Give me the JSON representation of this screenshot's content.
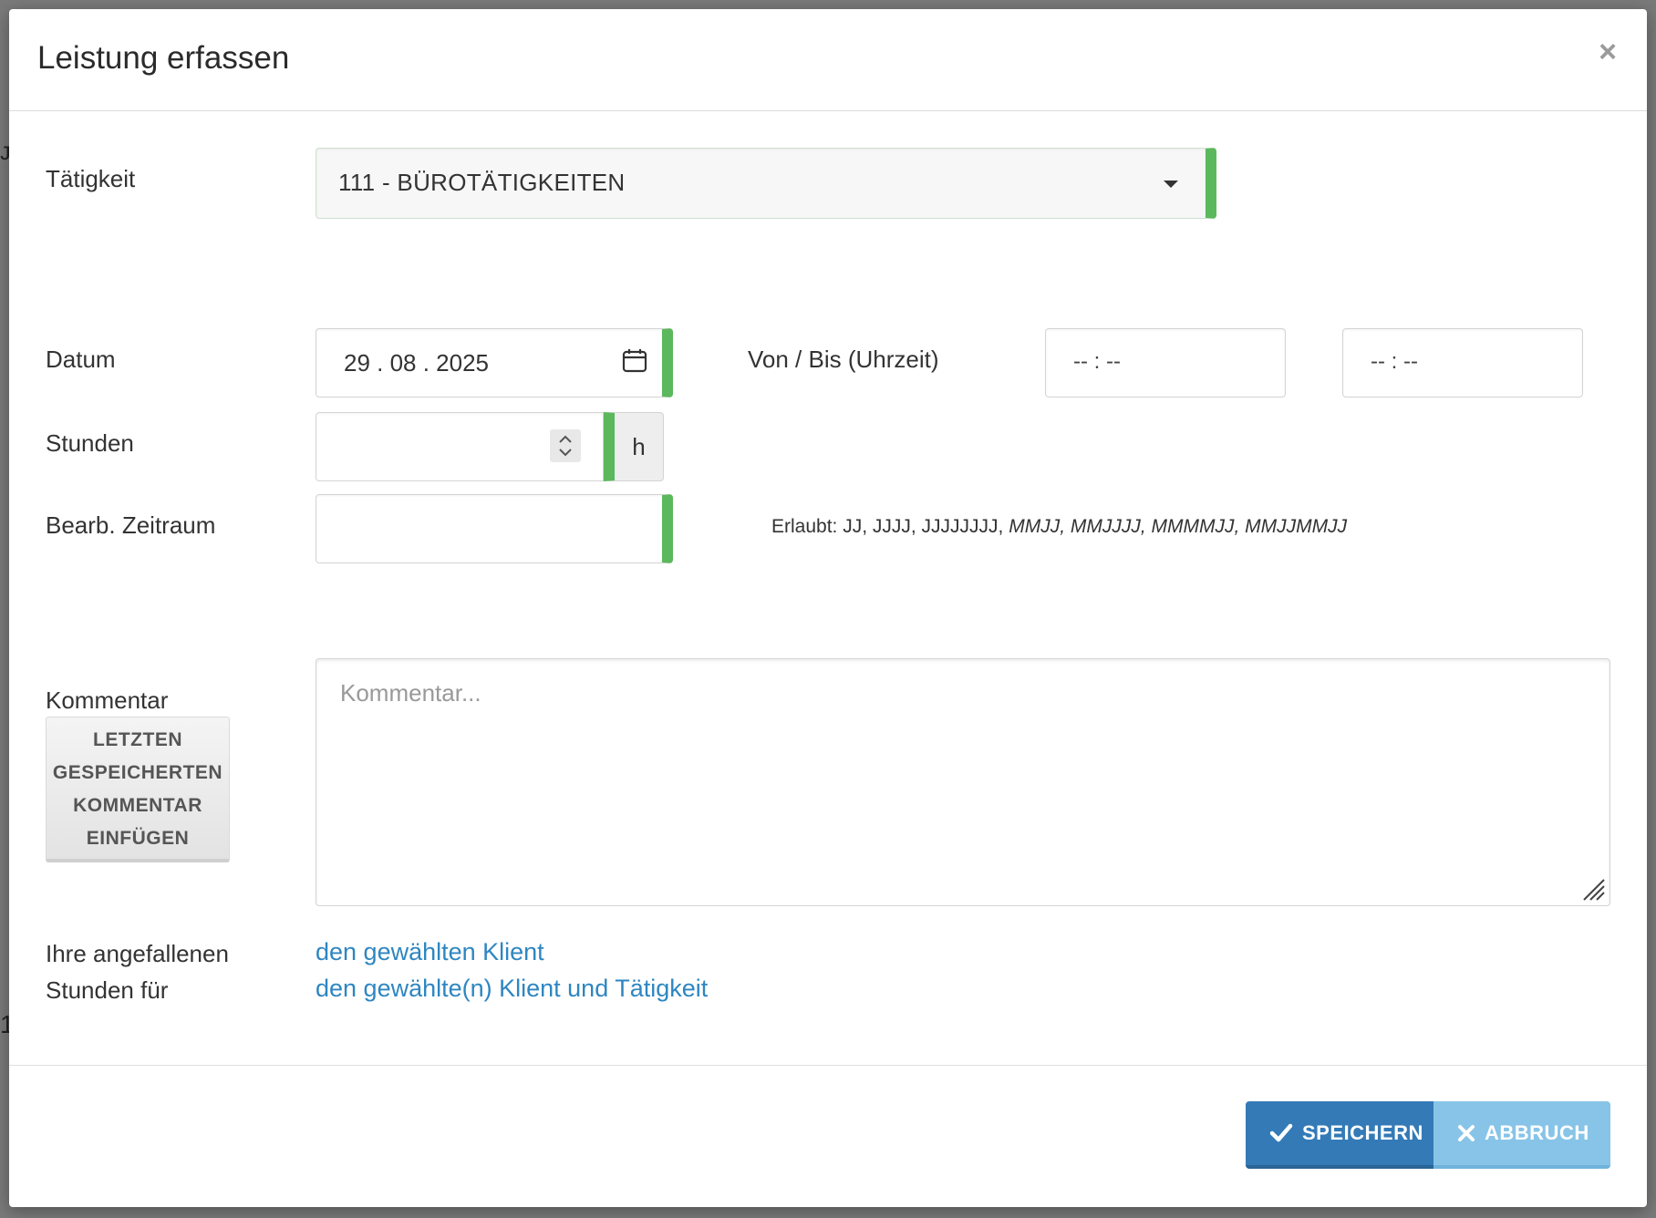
{
  "modal": {
    "title": "Leistung erfassen",
    "close_symbol": "×"
  },
  "fields": {
    "taetigkeit_label": "Tätigkeit",
    "taetigkeit_value": "111 - BÜROTÄTIGKEITEN",
    "datum_label": "Datum",
    "datum_value": "29 . 08 . 2025",
    "von_bis_label": "Von / Bis (Uhrzeit)",
    "von_value": "-- : --",
    "bis_value": "-- : --",
    "stunden_label": "Stunden",
    "stunden_unit": "h",
    "zeitraum_label": "Bearb. Zeitraum",
    "zeitraum_hint_prefix": "Erlaubt: JJ, JJJJ, JJJJJJJJ,",
    "zeitraum_hint_italic": "MMJJ, MMJJJJ, MMMMJJ, MMJJMMJJ",
    "kommentar_label": "Kommentar",
    "kommentar_placeholder": "Kommentar...",
    "insert_comment_button": [
      "LETZTEN",
      "GESPEICHERTEN",
      "KOMMENTAR",
      "EINFÜGEN"
    ]
  },
  "hours_links": {
    "label_line1": "Ihre angefallenen",
    "label_line2": "Stunden für",
    "link_client": "den gewählten Klient",
    "link_client_activity": "den gewählte(n) Klient und Tätigkeit"
  },
  "footer": {
    "save_label": "SPEICHERN",
    "cancel_label": "ABBRUCH"
  },
  "colors": {
    "accent_green": "#5cb85c",
    "primary_blue": "#337ab7",
    "cancel_blue": "#87c4e8",
    "link_blue": "#2e86c1"
  },
  "icons": {
    "calendar": "calendar-icon",
    "check": "check-icon",
    "cross": "x-icon",
    "stepper": "spinner-icon"
  }
}
